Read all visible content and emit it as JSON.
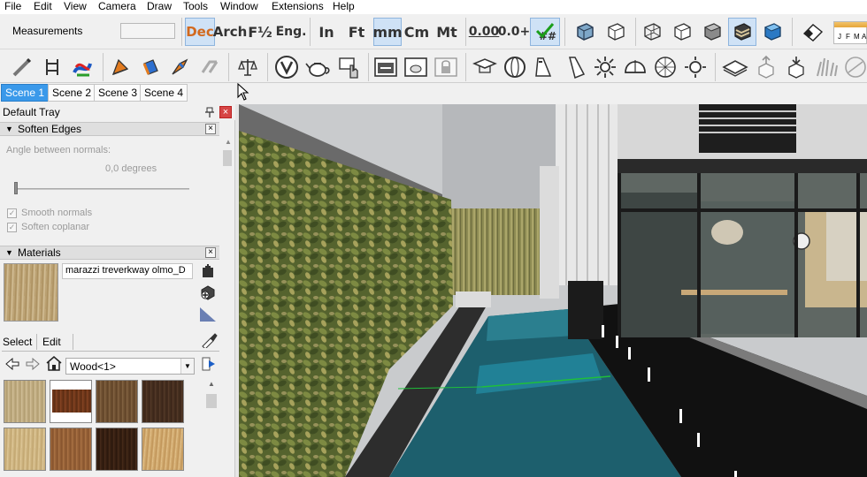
{
  "menu": [
    "File",
    "Edit",
    "View",
    "Camera",
    "Draw",
    "Tools",
    "Window",
    "Extensions",
    "Help"
  ],
  "toolbar": {
    "measurements_label": "Measurements",
    "measurements_value": "",
    "units": {
      "dec": "Dec",
      "arch": "Arch",
      "frac": "F½",
      "eng": "Eng.",
      "in": "In",
      "ft": "Ft",
      "mm": "mm",
      "cm": "Cm",
      "mt": "Mt",
      "precision_1": "0.00",
      "precision_2": "0.0+",
      "status_mark": "##"
    },
    "style_box_labels": [
      "J",
      "F",
      "M",
      "A"
    ]
  },
  "scenes": [
    "Scene 1",
    "Scene 2",
    "Scene 3",
    "Scene 4"
  ],
  "tray": {
    "title": "Default Tray",
    "soften": {
      "title": "Soften Edges",
      "angle_label": "Angle between normals:",
      "angle_value": "0,0  degrees",
      "smooth_label": "Smooth normals",
      "coplanar_label": "Soften coplanar"
    },
    "materials": {
      "title": "Materials",
      "name": "marazzi treverkway olmo_D",
      "tab_select": "Select",
      "tab_edit": "Edit",
      "library": "Wood<1>"
    }
  },
  "colors": {
    "accent_blue": "#3a99ea",
    "pool_water": "#1d5f6d",
    "hedge": "#4e5e2c",
    "toggle_active": "#cfe2f6"
  }
}
